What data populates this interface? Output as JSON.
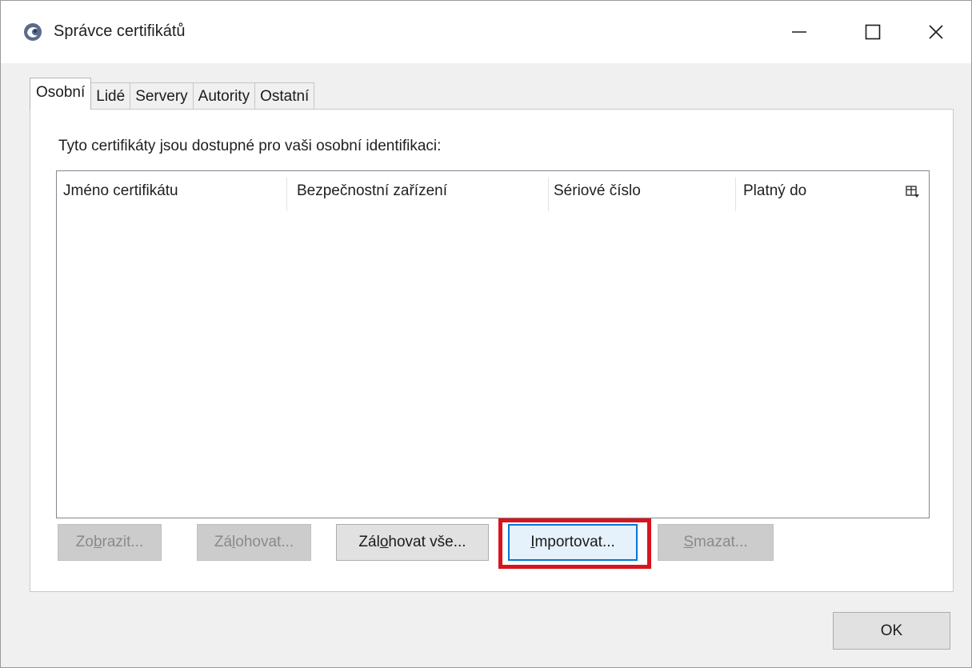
{
  "window": {
    "title": "Správce certifikátů",
    "controls": [
      "minimize-icon",
      "maximize-icon",
      "close-icon"
    ]
  },
  "tabs": [
    {
      "label": "Osobní",
      "active": true
    },
    {
      "label": "Lidé",
      "active": false
    },
    {
      "label": "Servery",
      "active": false
    },
    {
      "label": "Autority",
      "active": false
    },
    {
      "label": "Ostatní",
      "active": false
    }
  ],
  "panel": {
    "description": "Tyto certifikáty jsou dostupné pro vaši osobní identifikaci:"
  },
  "table": {
    "columns": [
      "Jméno certifikátu",
      "Bezpečnostní zařízení",
      "Sériové číslo",
      "Platný do"
    ],
    "rows": [],
    "column_picker_icon": "column-picker-icon"
  },
  "buttons": {
    "view": {
      "pre": "Zo",
      "accel": "b",
      "post": "razit...",
      "enabled": false
    },
    "backup": {
      "pre": "Zá",
      "accel": "l",
      "post": "ohovat...",
      "enabled": false
    },
    "backup_all": {
      "pre": "Zál",
      "accel": "o",
      "post": "hovat vše...",
      "enabled": true
    },
    "import": {
      "pre": "",
      "accel": "I",
      "post": "mportovat...",
      "enabled": true,
      "focused": true
    },
    "delete": {
      "pre": "",
      "accel": "S",
      "post": "mazat...",
      "enabled": false
    }
  },
  "ok_label": "OK",
  "colors": {
    "highlight": "#d9141f",
    "focus": "#0078d7"
  }
}
